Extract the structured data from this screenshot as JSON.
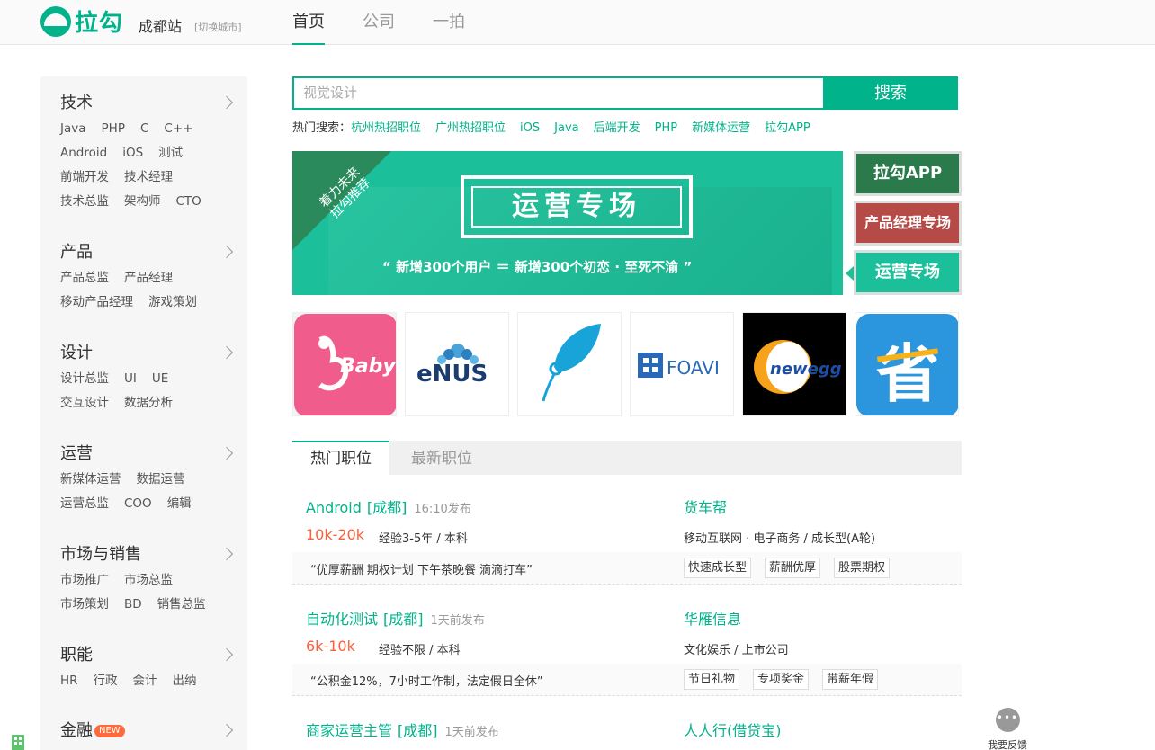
{
  "brand": {
    "logo_text": "拉勾",
    "city": "成都站",
    "switch_city": "[切换城市]",
    "accent": "#00b38a"
  },
  "nav": [
    {
      "label": "首页",
      "active": true
    },
    {
      "label": "公司"
    },
    {
      "label": "一拍"
    }
  ],
  "sidebar": [
    {
      "title": "技术",
      "rows": [
        [
          "Java",
          "PHP",
          "C",
          "C++"
        ],
        [
          "Android",
          "iOS",
          "测试"
        ],
        [
          "前端开发",
          "技术经理"
        ],
        [
          "技术总监",
          "架构师",
          "CTO"
        ]
      ]
    },
    {
      "title": "产品",
      "rows": [
        [
          "产品总监",
          "产品经理"
        ],
        [
          "移动产品经理",
          "游戏策划"
        ]
      ]
    },
    {
      "title": "设计",
      "rows": [
        [
          "设计总监",
          "UI",
          "UE"
        ],
        [
          "交互设计",
          "数据分析"
        ]
      ]
    },
    {
      "title": "运营",
      "rows": [
        [
          "新媒体运营",
          "数据运营"
        ],
        [
          "运营总监",
          "COO",
          "编辑"
        ]
      ]
    },
    {
      "title": "市场与销售",
      "rows": [
        [
          "市场推广",
          "市场总监"
        ],
        [
          "市场策划",
          "BD",
          "销售总监"
        ]
      ]
    },
    {
      "title": "职能",
      "rows": [
        [
          "HR",
          "行政",
          "会计",
          "出纳"
        ]
      ]
    },
    {
      "title": "金融",
      "badge": "NEW",
      "rows": []
    }
  ],
  "search": {
    "value": "视觉设计",
    "button": "搜索"
  },
  "hot_search": {
    "label": "热门搜索：",
    "items": [
      "杭州热招职位",
      "广州热招职位",
      "iOS",
      "Java",
      "后端开发",
      "PHP",
      "新媒体运营",
      "拉勾APP"
    ]
  },
  "banner": {
    "corner_line1": "着力未来",
    "corner_line2": "拉勾推荐",
    "title": "运营专场",
    "quote": "“ 新增300个用户 ＝ 新增300个初恋 · 至死不渝 ”"
  },
  "side_banners": [
    {
      "label": "拉勾APP",
      "color": "#2a7a4c"
    },
    {
      "label": "产品经理专场",
      "color": "#b54a46"
    },
    {
      "label": "运营专场",
      "color": "#1bc09a"
    }
  ],
  "company_logos": [
    "kangaroo-baby-logo",
    "enus-logo",
    "leaf-logo",
    "foavi-logo",
    "newegg-logo",
    "sheng-logo"
  ],
  "logo_texts": {
    "baby": "Baby",
    "enus": "eNUS",
    "foavi": "FOAVI",
    "newegg": "newegg",
    "sheng": "省"
  },
  "tabs": [
    {
      "label": "热门职位",
      "active": true
    },
    {
      "label": "最新职位"
    }
  ],
  "jobs": [
    {
      "title": "Android",
      "city": "[成都]",
      "time": "16:10发布",
      "salary": "10k-20k",
      "req": "经验3-5年 / 本科",
      "company": "货车帮",
      "industry": "移动互联网 · 电子商务 / 成长型(A轮)",
      "quote": "“优厚薪酬 期权计划 下午茶晚餐 滴滴打车”",
      "tags": [
        "快速成长型",
        "薪酬优厚",
        "股票期权"
      ]
    },
    {
      "title": "自动化测试",
      "city": "[成都]",
      "time": "1天前发布",
      "salary": "6k-10k",
      "req": "经验不限 / 本科",
      "company": "华雁信息",
      "industry": "文化娱乐 / 上市公司",
      "quote": "“公积金12%，7小时工作制，法定假日全休”",
      "tags": [
        "节日礼物",
        "专项奖金",
        "带薪年假"
      ]
    },
    {
      "title": "商家运营主管",
      "city": "[成都]",
      "time": "1天前发布",
      "company": "人人行(借贷宝)"
    }
  ],
  "feedback": {
    "bubble": "•••",
    "label": "我要反馈"
  }
}
